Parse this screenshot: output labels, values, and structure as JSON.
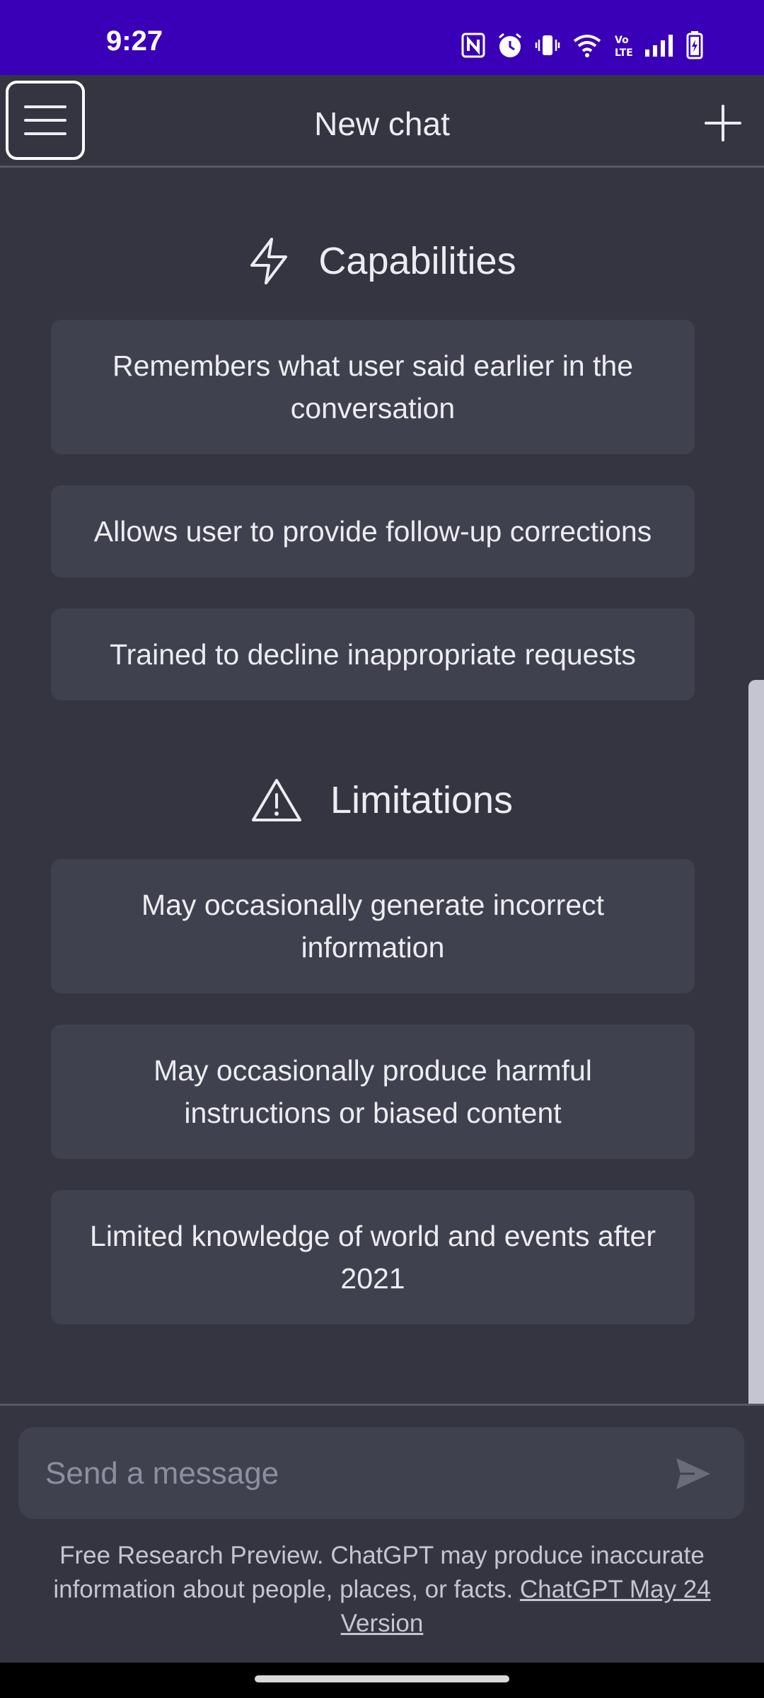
{
  "status_bar": {
    "time": "9:27",
    "icons": [
      "nfc-icon",
      "alarm-icon",
      "vibrate-icon",
      "wifi-icon",
      "volte-icon",
      "signal-icon",
      "battery-icon"
    ],
    "background": "#3a00b8"
  },
  "header": {
    "title": "New chat",
    "menu_icon": "hamburger-menu-icon",
    "new_chat_icon": "plus-icon"
  },
  "capabilities": {
    "icon": "lightning-icon",
    "title": "Capabilities",
    "items": [
      "Remembers what user said earlier in the conversation",
      "Allows user to provide follow-up corrections",
      "Trained to decline inappropriate requests"
    ]
  },
  "limitations": {
    "icon": "warning-triangle-icon",
    "title": "Limitations",
    "items": [
      "May occasionally generate incorrect information",
      "May occasionally produce harmful instructions or biased content",
      "Limited knowledge of world and events after 2021"
    ]
  },
  "composer": {
    "placeholder": "Send a message",
    "send_icon": "send-icon"
  },
  "footer": {
    "disclaimer": "Free Research Preview. ChatGPT may produce inaccurate information about people, places, or facts.",
    "link_label": "ChatGPT May 24 Version"
  },
  "colors": {
    "background": "#343541",
    "card": "#40414f",
    "text": "#ececf1",
    "muted": "#8e8ea0"
  }
}
